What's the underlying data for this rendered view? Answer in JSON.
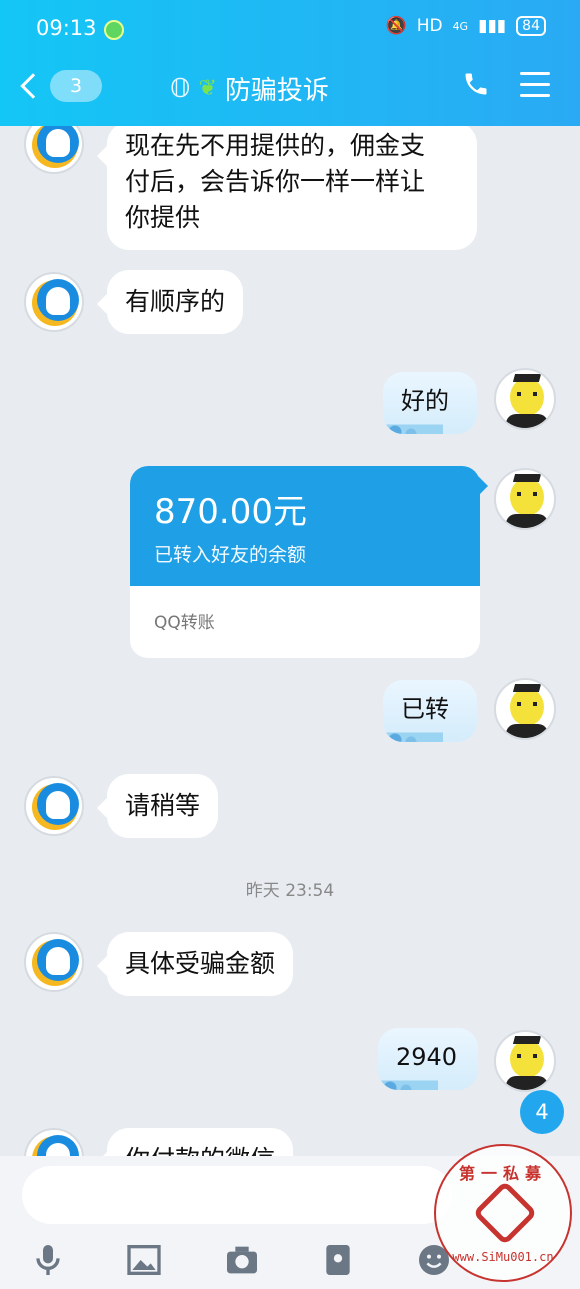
{
  "status_bar": {
    "time": "09:13",
    "signal_label": "HD",
    "network": "4G",
    "battery": "84"
  },
  "header": {
    "back_count": "3",
    "chat_title": "防骗投诉"
  },
  "messages": [
    {
      "side": "left",
      "text_lines": [
        "现在先不用提供的，佣金支",
        "付后，会告诉你一样一样让",
        "你提供"
      ]
    },
    {
      "side": "left",
      "text": "有顺序的"
    },
    {
      "side": "right",
      "text": "好的"
    },
    {
      "side": "right",
      "type": "transfer",
      "amount": "870.00元",
      "note": "已转入好友的余额",
      "footer": "QQ转账"
    },
    {
      "side": "right",
      "text": "已转"
    },
    {
      "side": "left",
      "text": "请稍等"
    },
    {
      "side": "left",
      "text": "具体受骗金额"
    },
    {
      "side": "right",
      "text": "2940"
    },
    {
      "side": "left",
      "text": "你付款的微信"
    }
  ],
  "timestamp": "昨天 23:54",
  "unread_badge": "4",
  "watermark": {
    "top_text": "第一私募",
    "bottom_text": "www.SiMu001.cn"
  }
}
